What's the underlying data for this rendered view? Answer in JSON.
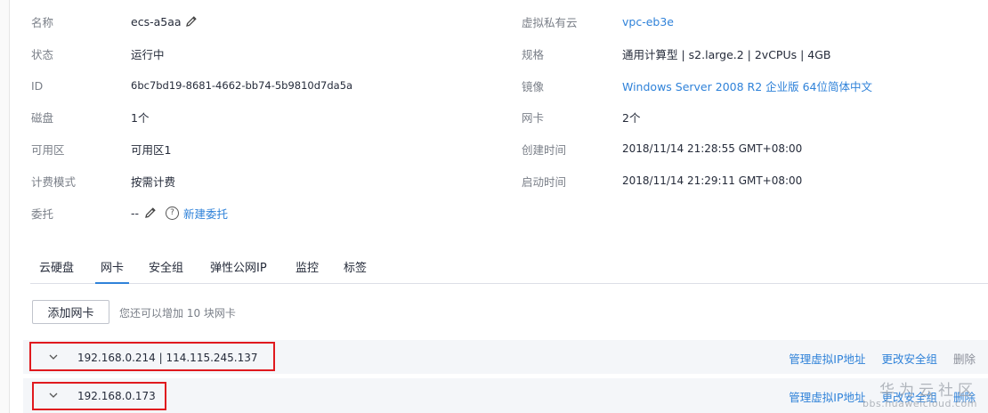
{
  "details": {
    "left": [
      {
        "label": "名称",
        "value": "ecs-a5aa"
      },
      {
        "label": "状态",
        "value": "运行中"
      },
      {
        "label": "ID",
        "value": "6bc7bd19-8681-4662-bb74-5b9810d7da5a"
      },
      {
        "label": "磁盘",
        "value": "1个"
      },
      {
        "label": "可用区",
        "value": "可用区1"
      },
      {
        "label": "计费模式",
        "value": "按需计费"
      },
      {
        "label": "委托",
        "value": "--",
        "link": "新建委托"
      }
    ],
    "right": [
      {
        "label": "虚拟私有云",
        "value": "vpc-eb3e"
      },
      {
        "label": "规格",
        "value": "通用计算型 | s2.large.2 | 2vCPUs | 4GB"
      },
      {
        "label": "镜像",
        "value": "Windows Server 2008 R2 企业版 64位简体中文"
      },
      {
        "label": "网卡",
        "value": "2个"
      },
      {
        "label": "创建时间",
        "value": "2018/11/14 21:28:55 GMT+08:00"
      },
      {
        "label": "启动时间",
        "value": "2018/11/14 21:29:11 GMT+08:00"
      }
    ]
  },
  "icons": {
    "edit": "pencil-icon",
    "help": "question-circle-icon",
    "expand": "chevron-down-icon"
  },
  "tabs": [
    "云硬盘",
    "网卡",
    "安全组",
    "弹性公网IP",
    "监控",
    "标签"
  ],
  "active_tab": "网卡",
  "nic_section": {
    "add_button": "添加网卡",
    "hint": "您还可以增加 10 块网卡",
    "nics": [
      {
        "ip": "192.168.0.214 | 114.115.245.137"
      },
      {
        "ip": "192.168.0.173"
      }
    ],
    "actions": {
      "manage_vip": "管理虚拟IP地址",
      "change_sg": "更改安全组",
      "delete": "删除"
    }
  },
  "watermark": {
    "line1": "华为云社区",
    "line2": "bbs.huaweicloud.com"
  },
  "colors": {
    "link": "#2f82d9",
    "highlight_box": "#e0191e",
    "row_bg": "#f4f6f9"
  }
}
